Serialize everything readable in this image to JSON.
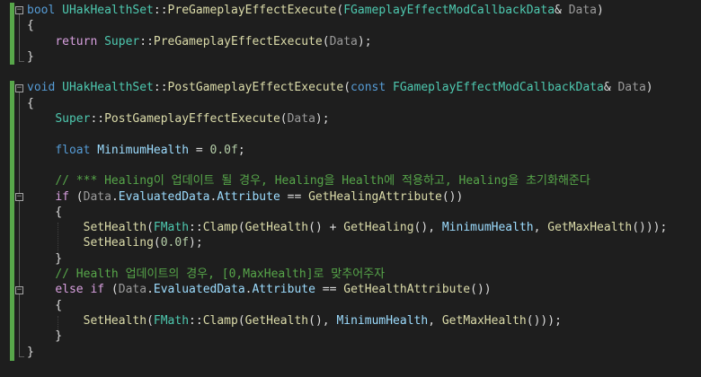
{
  "lines": [
    [
      {
        "c": "kw",
        "t": "bool"
      },
      {
        "c": "tx",
        "t": " "
      },
      {
        "c": "ty",
        "t": "UHakHealthSet"
      },
      {
        "c": "tx",
        "t": "::"
      },
      {
        "c": "fn",
        "t": "PreGameplayEffectExecute"
      },
      {
        "c": "tx",
        "t": "("
      },
      {
        "c": "ty",
        "t": "FGameplayEffectModCallbackData"
      },
      {
        "c": "tx",
        "t": "& "
      },
      {
        "c": "dim",
        "t": "Data"
      },
      {
        "c": "tx",
        "t": ")"
      }
    ],
    [
      {
        "c": "tx",
        "t": "{"
      }
    ],
    [
      {
        "c": "tx",
        "t": "    "
      },
      {
        "c": "kw2",
        "t": "return"
      },
      {
        "c": "tx",
        "t": " "
      },
      {
        "c": "ty",
        "t": "Super"
      },
      {
        "c": "tx",
        "t": "::"
      },
      {
        "c": "fn",
        "t": "PreGameplayEffectExecute"
      },
      {
        "c": "tx",
        "t": "("
      },
      {
        "c": "dim",
        "t": "Data"
      },
      {
        "c": "tx",
        "t": ");"
      }
    ],
    [
      {
        "c": "tx",
        "t": "}"
      }
    ],
    [],
    [
      {
        "c": "kw",
        "t": "void"
      },
      {
        "c": "tx",
        "t": " "
      },
      {
        "c": "ty",
        "t": "UHakHealthSet"
      },
      {
        "c": "tx",
        "t": "::"
      },
      {
        "c": "fn",
        "t": "PostGameplayEffectExecute"
      },
      {
        "c": "tx",
        "t": "("
      },
      {
        "c": "kw",
        "t": "const"
      },
      {
        "c": "tx",
        "t": " "
      },
      {
        "c": "ty",
        "t": "FGameplayEffectModCallbackData"
      },
      {
        "c": "tx",
        "t": "& "
      },
      {
        "c": "dim",
        "t": "Data"
      },
      {
        "c": "tx",
        "t": ")"
      }
    ],
    [
      {
        "c": "tx",
        "t": "{"
      }
    ],
    [
      {
        "c": "tx",
        "t": "    "
      },
      {
        "c": "ty",
        "t": "Super"
      },
      {
        "c": "tx",
        "t": "::"
      },
      {
        "c": "fn",
        "t": "PostGameplayEffectExecute"
      },
      {
        "c": "tx",
        "t": "("
      },
      {
        "c": "dim",
        "t": "Data"
      },
      {
        "c": "tx",
        "t": ");"
      }
    ],
    [],
    [
      {
        "c": "tx",
        "t": "    "
      },
      {
        "c": "kw",
        "t": "float"
      },
      {
        "c": "tx",
        "t": " "
      },
      {
        "c": "var",
        "t": "MinimumHealth"
      },
      {
        "c": "tx",
        "t": " = "
      },
      {
        "c": "num",
        "t": "0.0f"
      },
      {
        "c": "tx",
        "t": ";"
      }
    ],
    [],
    [
      {
        "c": "tx",
        "t": "    "
      },
      {
        "c": "cm",
        "t": "// *** Healing이 업데이트 될 경우, Healing을 Health에 적용하고, Healing을 초기화해준다"
      }
    ],
    [
      {
        "c": "tx",
        "t": "    "
      },
      {
        "c": "kw2",
        "t": "if"
      },
      {
        "c": "tx",
        "t": " ("
      },
      {
        "c": "dim",
        "t": "Data"
      },
      {
        "c": "tx",
        "t": "."
      },
      {
        "c": "var",
        "t": "EvaluatedData"
      },
      {
        "c": "tx",
        "t": "."
      },
      {
        "c": "var",
        "t": "Attribute"
      },
      {
        "c": "tx",
        "t": " == "
      },
      {
        "c": "fn",
        "t": "GetHealingAttribute"
      },
      {
        "c": "tx",
        "t": "())"
      }
    ],
    [
      {
        "c": "tx",
        "t": "    {"
      }
    ],
    [
      {
        "c": "tx",
        "t": "        "
      },
      {
        "c": "fn",
        "t": "SetHealth"
      },
      {
        "c": "tx",
        "t": "("
      },
      {
        "c": "ty",
        "t": "FMath"
      },
      {
        "c": "tx",
        "t": "::"
      },
      {
        "c": "fn",
        "t": "Clamp"
      },
      {
        "c": "tx",
        "t": "("
      },
      {
        "c": "fn",
        "t": "GetHealth"
      },
      {
        "c": "tx",
        "t": "() + "
      },
      {
        "c": "fn",
        "t": "GetHealing"
      },
      {
        "c": "tx",
        "t": "(), "
      },
      {
        "c": "var",
        "t": "MinimumHealth"
      },
      {
        "c": "tx",
        "t": ", "
      },
      {
        "c": "fn",
        "t": "GetMaxHealth"
      },
      {
        "c": "tx",
        "t": "()));"
      }
    ],
    [
      {
        "c": "tx",
        "t": "        "
      },
      {
        "c": "fn",
        "t": "SetHealing"
      },
      {
        "c": "tx",
        "t": "("
      },
      {
        "c": "num",
        "t": "0.0f"
      },
      {
        "c": "tx",
        "t": ");"
      }
    ],
    [
      {
        "c": "tx",
        "t": "    }"
      }
    ],
    [
      {
        "c": "tx",
        "t": "    "
      },
      {
        "c": "cm",
        "t": "// Health 업데이트의 경우, [0,MaxHealth]로 맞추어주자"
      }
    ],
    [
      {
        "c": "tx",
        "t": "    "
      },
      {
        "c": "kw2",
        "t": "else"
      },
      {
        "c": "tx",
        "t": " "
      },
      {
        "c": "kw2",
        "t": "if"
      },
      {
        "c": "tx",
        "t": " ("
      },
      {
        "c": "dim",
        "t": "Data"
      },
      {
        "c": "tx",
        "t": "."
      },
      {
        "c": "var",
        "t": "EvaluatedData"
      },
      {
        "c": "tx",
        "t": "."
      },
      {
        "c": "var",
        "t": "Attribute"
      },
      {
        "c": "tx",
        "t": " == "
      },
      {
        "c": "fn",
        "t": "GetHealthAttribute"
      },
      {
        "c": "tx",
        "t": "())"
      }
    ],
    [
      {
        "c": "tx",
        "t": "    {"
      }
    ],
    [
      {
        "c": "tx",
        "t": "        "
      },
      {
        "c": "fn",
        "t": "SetHealth"
      },
      {
        "c": "tx",
        "t": "("
      },
      {
        "c": "ty",
        "t": "FMath"
      },
      {
        "c": "tx",
        "t": "::"
      },
      {
        "c": "fn",
        "t": "Clamp"
      },
      {
        "c": "tx",
        "t": "("
      },
      {
        "c": "fn",
        "t": "GetHealth"
      },
      {
        "c": "tx",
        "t": "(), "
      },
      {
        "c": "var",
        "t": "MinimumHealth"
      },
      {
        "c": "tx",
        "t": ", "
      },
      {
        "c": "fn",
        "t": "GetMaxHealth"
      },
      {
        "c": "tx",
        "t": "()));"
      }
    ],
    [
      {
        "c": "tx",
        "t": "    }"
      }
    ],
    [
      {
        "c": "tx",
        "t": "}"
      }
    ]
  ],
  "colors": {
    "background": "#1e1e1e",
    "keyword": "#569cd6",
    "control_keyword": "#d8a0df",
    "type": "#4ec9b0",
    "function": "#dcdcaa",
    "variable": "#9cdcfe",
    "number": "#b5cea8",
    "comment": "#57a64a",
    "change_bar": "#57a64a"
  },
  "icons": {
    "fold": "collapse-minus-icon"
  }
}
